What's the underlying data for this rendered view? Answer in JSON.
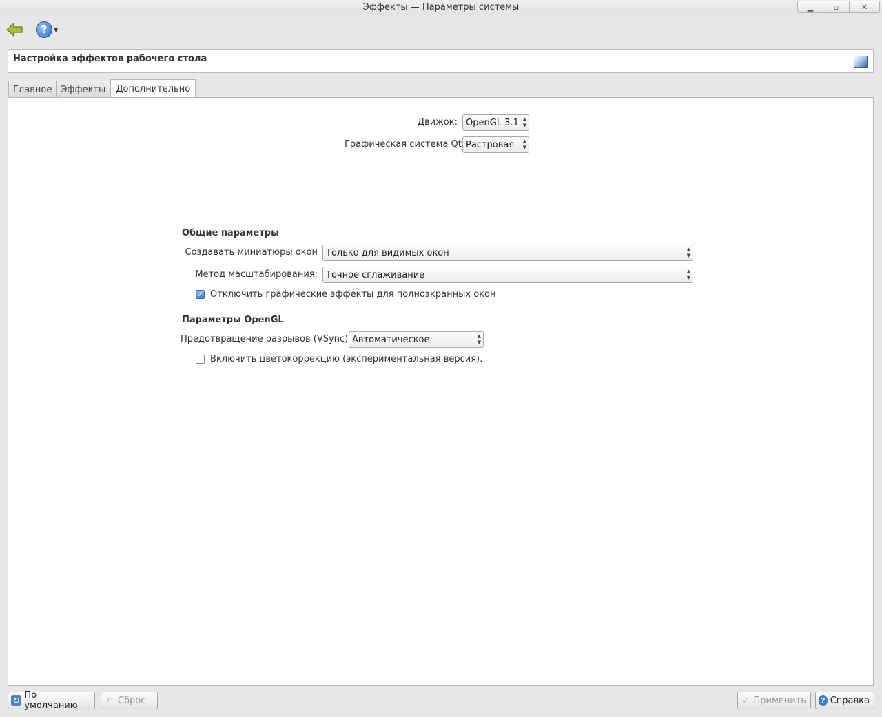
{
  "window": {
    "title": "Эффекты — Параметры системы",
    "minimize_glyph": "▁",
    "maximize_glyph": "▫",
    "close_glyph": "✕"
  },
  "toolbar": {
    "back_icon": "back-arrow-icon",
    "help_glyph": "?",
    "help_dropdown_glyph": "▼"
  },
  "header": {
    "title": "Настройка эффектов рабочего стола"
  },
  "tabs": [
    {
      "label": "Главное"
    },
    {
      "label": "Эффекты"
    },
    {
      "label": "Дополнительно",
      "active": true
    }
  ],
  "backend": {
    "engine_label": "Движок:",
    "engine_value": "OpenGL 3.1",
    "qt_label": "Графическая система Qt:",
    "qt_value": "Растровая"
  },
  "general": {
    "heading": "Общие параметры",
    "thumbnails_label": "Создавать миниатюры окон",
    "thumbnails_value": "Только для видимых окон",
    "scale_label": "Метод масштабирования:",
    "scale_value": "Точное сглаживание",
    "disable_fullscreen_label": "Отключить графические эффекты для полноэкранных окон",
    "disable_fullscreen_checked": true
  },
  "opengl": {
    "heading": "Параметры OpenGL",
    "vsync_label": "Предотвращение разрывов (VSync)",
    "vsync_value": "Автоматическое",
    "color_correction_label": "Включить цветокоррекцию (экспериментальная версия).",
    "color_correction_checked": false
  },
  "buttons": {
    "defaults": "По умолчанию",
    "reset": "Сброс",
    "apply": "Применить",
    "help": "Справка"
  },
  "glyphs": {
    "check": "✓",
    "spin_up": "▲",
    "spin_down": "▼"
  },
  "colors": {
    "accent": "#3d7ec8",
    "back_arrow": "#8fb234"
  }
}
